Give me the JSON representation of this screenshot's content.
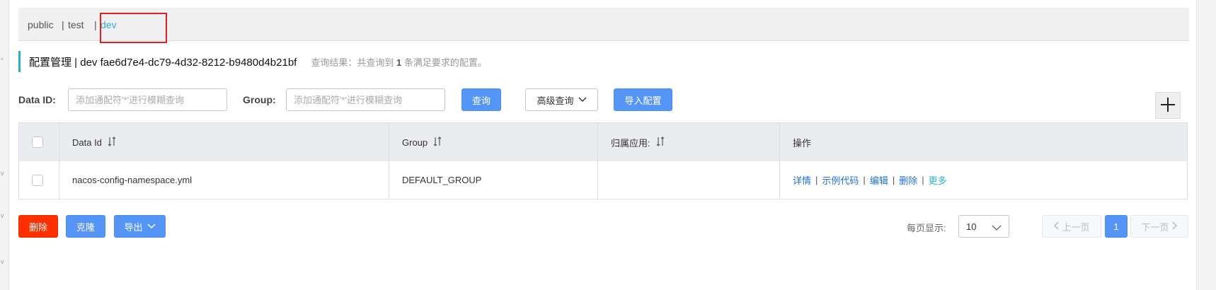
{
  "namespaces": {
    "items": [
      {
        "label": "public"
      },
      {
        "label": "test"
      },
      {
        "label": "dev"
      }
    ],
    "separator": "|",
    "active": "dev"
  },
  "header": {
    "title": "配置管理 | dev fae6d7e4-dc79-4d32-8212-b9480d4b21bf",
    "result_prefix": "查询结果：共查询到",
    "result_count": "1",
    "result_suffix": "条满足要求的配置。"
  },
  "search": {
    "data_id_label": "Data ID:",
    "data_id_placeholder": "添加通配符'*'进行模糊查询",
    "data_id_value": "",
    "group_label": "Group:",
    "group_placeholder": "添加通配符'*'进行模糊查询",
    "group_value": "",
    "query_button": "查询",
    "advanced_button": "高级查询",
    "import_button": "导入配置"
  },
  "table": {
    "columns": [
      "Data Id",
      "Group",
      "归属应用:",
      "操作"
    ],
    "rows": [
      {
        "data_id": "nacos-config-namespace.yml",
        "group": "DEFAULT_GROUP",
        "app": "",
        "actions": [
          "详情",
          "示例代码",
          "编辑",
          "删除",
          "更多"
        ]
      }
    ]
  },
  "bulk_actions": {
    "delete": "删除",
    "clone": "克隆",
    "export": "导出"
  },
  "pagination": {
    "page_size_label": "每页显示:",
    "page_size": "10",
    "prev": "上一页",
    "current_page": "1",
    "next": "下一页"
  },
  "colors": {
    "accent": "#2ab0c6",
    "primary": "#5595f5",
    "danger": "#ff3000",
    "link": "#1e6fd0",
    "highlight_box": "#e02020"
  },
  "icons": {
    "sort": "sort-arrows-icon",
    "chevron": "chevron-down-icon",
    "add": "plus-icon"
  }
}
